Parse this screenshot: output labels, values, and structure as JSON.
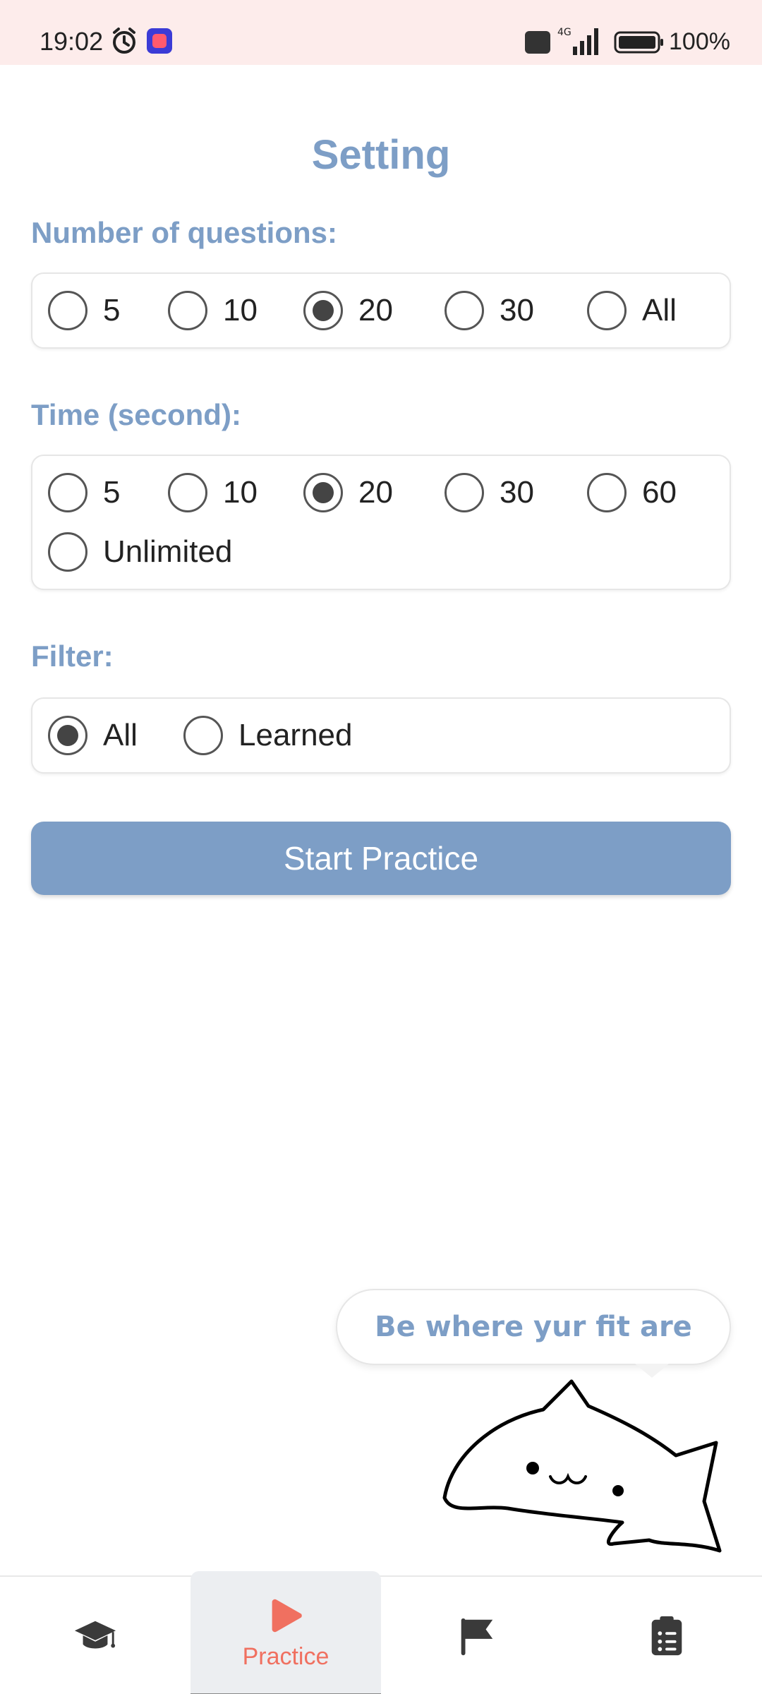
{
  "status_bar": {
    "time": "19:02",
    "battery_text": "100%",
    "icons": [
      "alarm-icon",
      "app-notification-icon",
      "volte-icon",
      "signal-4g-icon",
      "battery-icon"
    ]
  },
  "page": {
    "title": "Setting"
  },
  "questions": {
    "label": "Number of questions:",
    "options": [
      "5",
      "10",
      "20",
      "30",
      "All"
    ],
    "selected": "20"
  },
  "time": {
    "label": "Time (second):",
    "options": [
      "5",
      "10",
      "20",
      "30",
      "60",
      "Unlimited"
    ],
    "selected": "20"
  },
  "filter": {
    "label": "Filter:",
    "options": [
      "All",
      "Learned"
    ],
    "selected": "All"
  },
  "start_button": {
    "label": "Start Practice"
  },
  "mascot": {
    "speech": "Be where yur fit are"
  },
  "bottom_nav": {
    "items": [
      {
        "icon": "graduation-cap-icon",
        "label": ""
      },
      {
        "icon": "play-icon",
        "label": "Practice",
        "active": true
      },
      {
        "icon": "flag-icon",
        "label": ""
      },
      {
        "icon": "clipboard-list-icon",
        "label": ""
      }
    ]
  },
  "colors": {
    "accent": "#7d9ec6",
    "status_bar_bg": "#fdeceb",
    "active_nav": "#f07060"
  }
}
